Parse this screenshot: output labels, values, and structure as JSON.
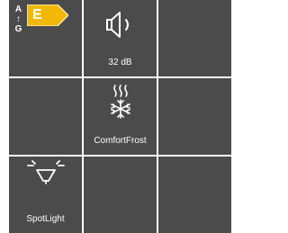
{
  "energy_label": {
    "scale_top": "A",
    "scale_bottom": "G",
    "class": "E",
    "class_color": "#f2b807"
  },
  "noise": {
    "value": "32 dB",
    "icon": "speaker-icon"
  },
  "comfortfrost": {
    "label": "ComfortFrost",
    "icon": "snowflake-heat-icon"
  },
  "spotlight": {
    "label": "SpotLight",
    "icon": "lamp-light-icon"
  },
  "colors": {
    "tile_background": "#4b4b4b",
    "page_background": "#ffffff",
    "text": "#ffffff"
  }
}
